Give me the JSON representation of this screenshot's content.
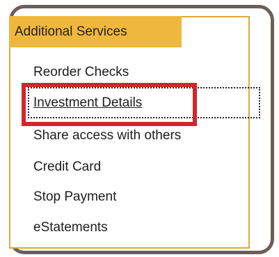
{
  "menu": {
    "header_label": "Additional Services",
    "items": [
      {
        "label": "Reorder Checks"
      },
      {
        "label": "Investment Details"
      },
      {
        "label": "Share access with others"
      },
      {
        "label": "Credit Card"
      },
      {
        "label": "Stop Payment"
      },
      {
        "label": "eStatements"
      }
    ]
  },
  "colors": {
    "frame_border": "#6b5f58",
    "header_background": "#f0b73e",
    "menu_border": "#e0a736",
    "highlight_border": "#d1262b"
  }
}
